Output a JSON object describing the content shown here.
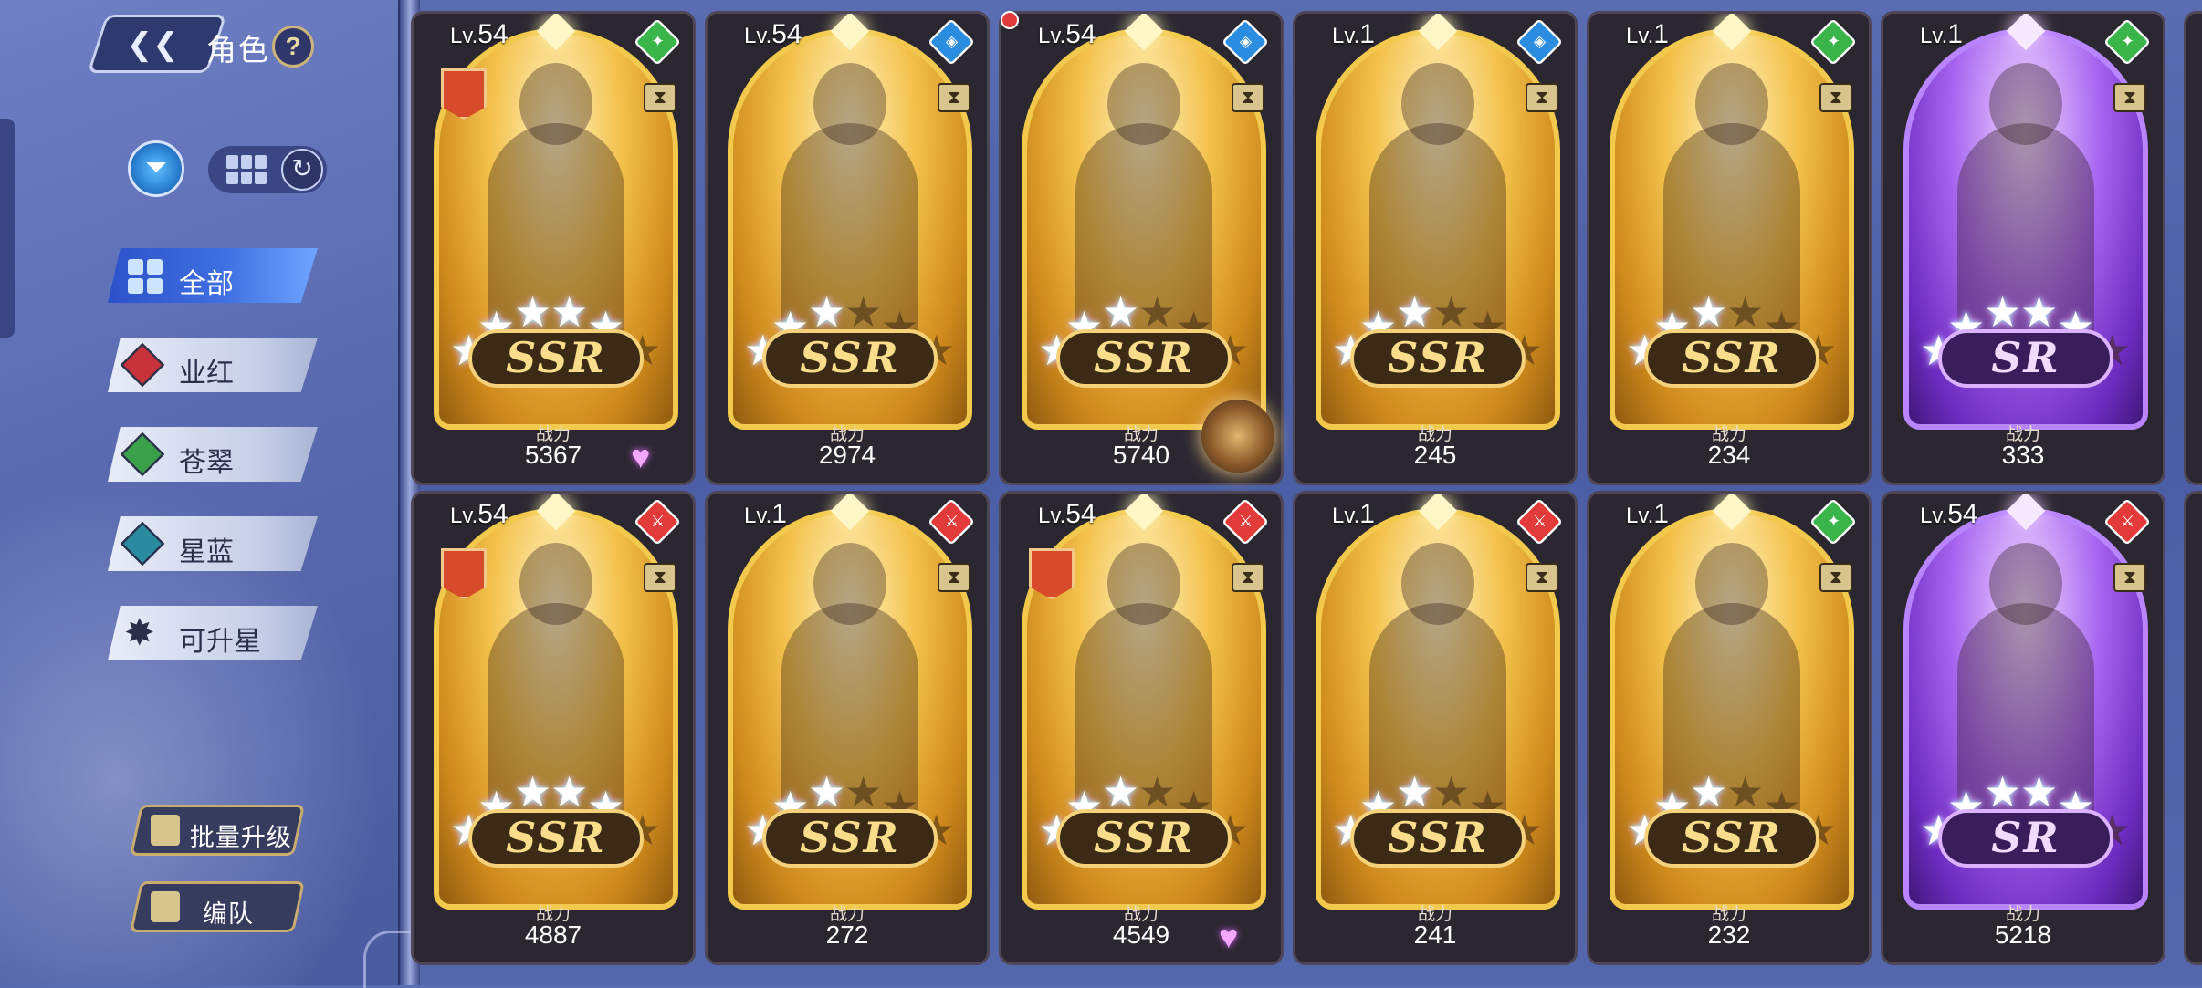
{
  "header": {
    "title": "角色",
    "help": "?"
  },
  "categories": [
    {
      "label": "全部",
      "active": true
    },
    {
      "label": "业红",
      "color": "#c8323a"
    },
    {
      "label": "苍翠",
      "color": "#3aa14a"
    },
    {
      "label": "星蓝",
      "color": "#2a8aa0"
    },
    {
      "label": "可升星"
    }
  ],
  "actions": {
    "bulk_upgrade": "批量升级",
    "formation": "编队"
  },
  "power_label": "战力",
  "level_prefix": "Lv.",
  "cards": [
    {
      "level": "54",
      "rarity": "SSR",
      "power": "5367",
      "element": "green",
      "stars": 5,
      "heart": true,
      "guild": true
    },
    {
      "level": "54",
      "rarity": "SSR",
      "power": "2974",
      "element": "blue",
      "stars": 3,
      "red_dot": true
    },
    {
      "level": "54",
      "rarity": "SSR",
      "power": "5740",
      "element": "blue",
      "stars": 3
    },
    {
      "level": "1",
      "rarity": "SSR",
      "power": "245",
      "element": "blue",
      "stars": 3
    },
    {
      "level": "1",
      "rarity": "SSR",
      "power": "234",
      "element": "green",
      "stars": 3
    },
    {
      "level": "1",
      "rarity": "SR",
      "power": "333",
      "element": "green",
      "stars": 5
    },
    {
      "level": "54",
      "rarity": "SSR",
      "power": "4887",
      "element": "red",
      "stars": 5,
      "guild": true
    },
    {
      "level": "1",
      "rarity": "SSR",
      "power": "272",
      "element": "red",
      "stars": 3
    },
    {
      "level": "54",
      "rarity": "SSR",
      "power": "4549",
      "element": "red",
      "stars": 3,
      "heart": true,
      "guild": true
    },
    {
      "level": "1",
      "rarity": "SSR",
      "power": "241",
      "element": "red",
      "stars": 3
    },
    {
      "level": "1",
      "rarity": "SSR",
      "power": "232",
      "element": "green",
      "stars": 3
    },
    {
      "level": "54",
      "rarity": "SR",
      "power": "5218",
      "element": "red",
      "stars": 5
    }
  ]
}
